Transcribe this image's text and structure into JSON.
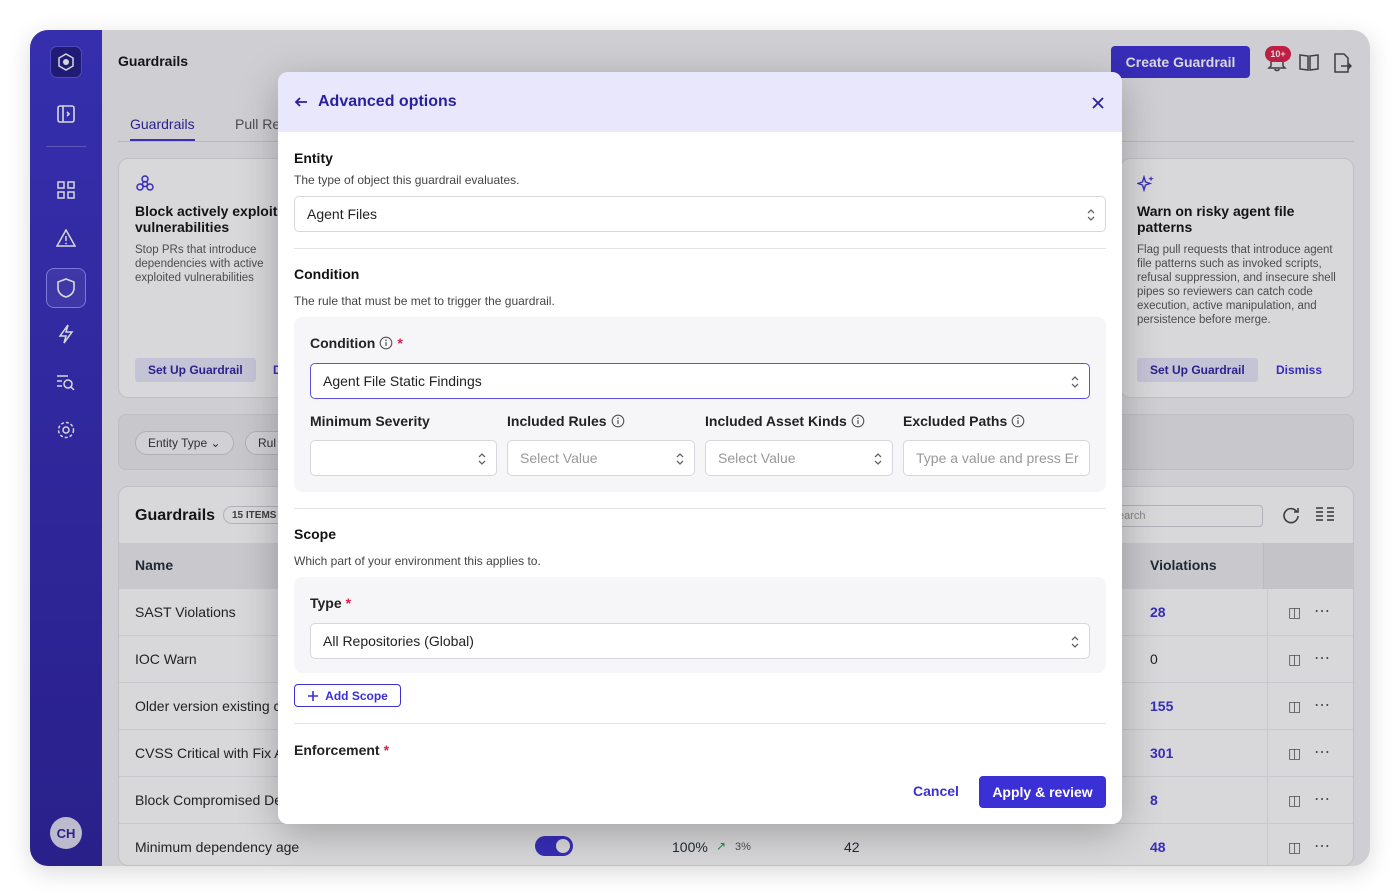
{
  "app": {
    "page_title": "Guardrails",
    "create_button": "Create Guardrail",
    "notification_badge": "10+",
    "avatar_initials": "CH"
  },
  "tabs": [
    "Guardrails",
    "Pull Re"
  ],
  "cards": [
    {
      "title": "Block actively exploit vulnerabilities",
      "description": "Stop PRs that introduce dependencies with active exploited vulnerabilities",
      "setup_label": "Set Up Guardrail",
      "dismiss_label": "D"
    },
    {
      "title": "Warn on risky agent file patterns",
      "description": "Flag pull requests that introduce agent file patterns such as invoked scripts, refusal suppression, and insecure shell pipes so reviewers can catch code execution, active manipulation, and persistence before merge.",
      "setup_label": "Set Up Guardrail",
      "dismiss_label": "Dismiss"
    }
  ],
  "filters": {
    "entity_type": "Entity Type",
    "rule": "Rul"
  },
  "table": {
    "title": "Guardrails",
    "items_count": "15 ITEMS",
    "search_placeholder": "earch",
    "columns": {
      "name": "Name",
      "violations": "Violations"
    },
    "rows": [
      {
        "name": "SAST Violations",
        "violations": "28"
      },
      {
        "name": "IOC Warn",
        "violations": "0"
      },
      {
        "name": "Older version existing c",
        "violations": "155"
      },
      {
        "name": "CVSS Critical with Fix A",
        "violations": "301"
      },
      {
        "name": "Block Compromised De",
        "violations": "8"
      },
      {
        "name": "Minimum dependency age",
        "violations": "48",
        "percent": "100%",
        "trend": "3%",
        "count": "42"
      }
    ]
  },
  "modal": {
    "title": "Advanced options",
    "entity": {
      "title": "Entity",
      "description": "The type of object this guardrail evaluates.",
      "value": "Agent Files"
    },
    "condition": {
      "title": "Condition",
      "description": "The rule that must be met to trigger the guardrail.",
      "field_label": "Condition",
      "required_mark": "*",
      "value": "Agent File Static Findings",
      "min_severity_label": "Minimum Severity",
      "min_severity_value": "",
      "included_rules_label": "Included Rules",
      "included_rules_placeholder": "Select Value",
      "asset_kinds_label": "Included Asset Kinds",
      "asset_kinds_placeholder": "Select Value",
      "excluded_paths_label": "Excluded Paths",
      "excluded_paths_placeholder": "Type a value and press Er"
    },
    "scope": {
      "title": "Scope",
      "description": "Which part of your environment this applies to.",
      "type_label": "Type",
      "required_mark": "*",
      "type_value": "All Repositories (Global)",
      "add_scope": "Add Scope"
    },
    "enforcement": {
      "title": "Enforcement",
      "required_mark": "*"
    },
    "cancel": "Cancel",
    "apply": "Apply & review"
  }
}
